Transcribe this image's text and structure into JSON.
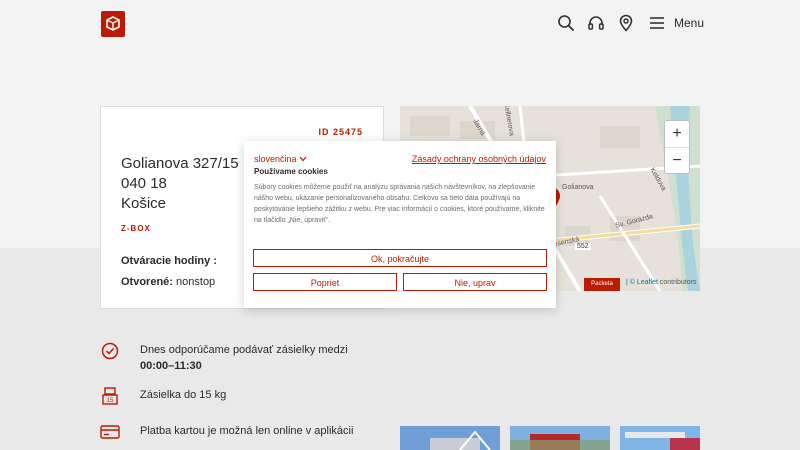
{
  "header": {
    "menu_label": "Menu"
  },
  "point": {
    "id_text": "ID 25475",
    "address_lines": [
      "Golianova 327/15",
      "040 18",
      "Košice"
    ],
    "type": "Z-BOX",
    "hours_label": "Otváracie hodiny :",
    "open_label": "Otvorené:",
    "open_value": "nonstop"
  },
  "info": {
    "recommend_prefix": "Dnes odporúčame podávať zásielky medzi ",
    "recommend_time": "00:00–11:30",
    "weight": "Zásielka do 15 kg",
    "payment": "Platba kartou je možná len online v aplikácii"
  },
  "map": {
    "zoom_in": "+",
    "zoom_out": "−",
    "badge": "Packeta",
    "leaflet": "© Leaflet",
    "contributors": "contributors",
    "streets": [
      "Golianova",
      "Keldova",
      "Sv. Gorazda",
      "552",
      "Kellnerova",
      "Jarná",
      "Jesenská"
    ]
  },
  "cookie": {
    "language": "slovenčina",
    "privacy_link": "Zásady ochrany osobných údajov",
    "title": "Používame cookies",
    "text": "Súbory cookies môžeme použiť na analýzu správania našich návštevníkov, na zlepšovanie nášho webu, ukázanie personalizovaného obsahu. Celkovo sa tieto dáta používajú na poskytovanie lepšieho zážitku z webu. Pre viac informácií o cookies, ktoré používame, kliknite na tlačidlo „Nie, upraviť“.",
    "accept": "Ok, pokračujte",
    "reject": "Popriet",
    "adjust": "Nie, uprav"
  },
  "colors": {
    "brand": "#ba1b02",
    "background": "#f3f3f3",
    "link": "#0078a8"
  }
}
